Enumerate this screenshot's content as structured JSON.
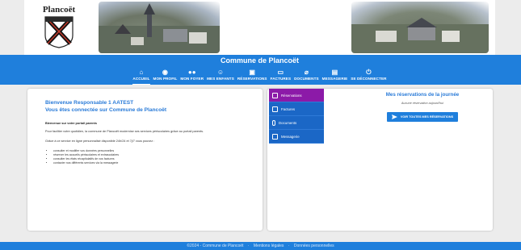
{
  "header": {
    "logo_name": "Plancoët",
    "commune_title": "Commune de Plancoët"
  },
  "nav": [
    {
      "label": "ACCUEIL",
      "icon": "home-icon",
      "active": true
    },
    {
      "label": "MON PROFIL",
      "icon": "account-icon"
    },
    {
      "label": "MON FOYER",
      "icon": "family-icon"
    },
    {
      "label": "MES ENFANTS",
      "icon": "child-icon"
    },
    {
      "label": "RÉSERVATIONS",
      "icon": "calendar-icon"
    },
    {
      "label": "FACTURES",
      "icon": "invoice-icon"
    },
    {
      "label": "DOCUMENTS",
      "icon": "attachment-icon"
    },
    {
      "label": "MESSAGERIE",
      "icon": "message-icon"
    },
    {
      "label": "SE DÉCONNECTER",
      "icon": "power-icon"
    }
  ],
  "welcome": {
    "title": "Bienvenue Responsable 1 AATEST",
    "subtitle": "Vous êtes connectée sur Commune de Plancoët",
    "portal_head": "Bienvenue sur votre portail parents",
    "para1": "Pour faciliter votre quotidien, la commune de Plancoët modernise ses services périscolaires grâce au portail parents.",
    "para2": "Grâce à ce service en ligne personnalisé disponible 24h/24 et 7j/7 vous pouvez :",
    "bullets": [
      "consulter et modifier vos données personnelles",
      "réserver les accueils périscolaires et extrascolaires",
      "consulter les états récapitulatifs de vos factures",
      "contacter nos différents services via la messagerie"
    ]
  },
  "side_menu": [
    {
      "label": "Réservations",
      "icon": "calendar-icon",
      "active": true
    },
    {
      "label": "Factures",
      "icon": "invoice-icon"
    },
    {
      "label": "Documents",
      "icon": "attachment-icon"
    },
    {
      "label": "Messagerie",
      "icon": "message-icon"
    }
  ],
  "reservations": {
    "title": "Mes réservations de la journée",
    "none_text": "Aucune réservation aujourd'hui",
    "button_label": "VOIR TOUTES MES RÉSERVATIONS"
  },
  "footer": {
    "copyright": "©2024 - Commune de Plancoët",
    "legal": "Mentions légales",
    "privacy": "Données personnelles"
  },
  "colors": {
    "primary": "#1f7fdc",
    "active_menu": "#8c1aa8",
    "title_blue": "#2a7bd8"
  }
}
